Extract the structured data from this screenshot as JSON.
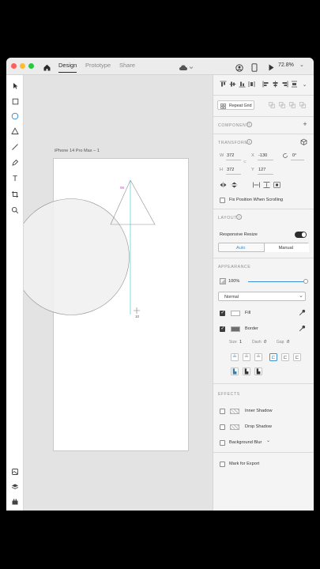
{
  "titlebar": {
    "tabs": [
      {
        "label": "Design"
      },
      {
        "label": "Prototype"
      },
      {
        "label": "Share"
      }
    ],
    "zoom": "72.8%",
    "icons": [
      "home-icon",
      "cloud-icon",
      "account-icon",
      "device-preview-icon",
      "play-icon"
    ]
  },
  "toolbar": {
    "tools": [
      "select-tool-icon",
      "rectangle-tool-icon",
      "ellipse-tool-icon",
      "triangle-tool-icon",
      "line-tool-icon",
      "pen-tool-icon",
      "text-tool-icon",
      "artboard-tool-icon",
      "zoom-tool-icon"
    ],
    "bottom": [
      "assets-icon",
      "layers-icon",
      "plugins-icon"
    ]
  },
  "canvas": {
    "artboard_name": "iPhone 14 Pro Max – 1",
    "measure_top": "96",
    "measure_bottom": "10"
  },
  "panel": {
    "repeat_grid": "Repeat Grid",
    "component_title": "COMPONENT",
    "transform_title": "TRANSFORM",
    "w_label": "W",
    "w_value": "372",
    "x_label": "X",
    "x_value": "-130",
    "rotation_value": "0°",
    "h_label": "H",
    "h_value": "372",
    "y_label": "Y",
    "y_value": "127",
    "fix_position": "Fix Position When Scrolling",
    "layout_title": "LAYOUT",
    "responsive_resize": "Responsive Resize",
    "auto_label": "Auto",
    "manual_label": "Manual",
    "appearance_title": "APPEARANCE",
    "opacity": "100%",
    "opacity_level": 1.0,
    "blend_mode": "Normal",
    "fill_label": "Fill",
    "border_label": "Border",
    "size_label": "Size",
    "size_value": "1",
    "dash_label": "Dash",
    "dash_value": "0",
    "gap_label": "Gap",
    "gap_value": "0",
    "effects_title": "EFFECTS",
    "inner_shadow": "Inner Shadow",
    "drop_shadow": "Drop Shadow",
    "background_blur": "Background Blur",
    "mark_export": "Mark for Export",
    "colors": {
      "accent": "#3d8fd1",
      "guide": "#4ec9d4",
      "measure": "#c04fc0"
    }
  }
}
